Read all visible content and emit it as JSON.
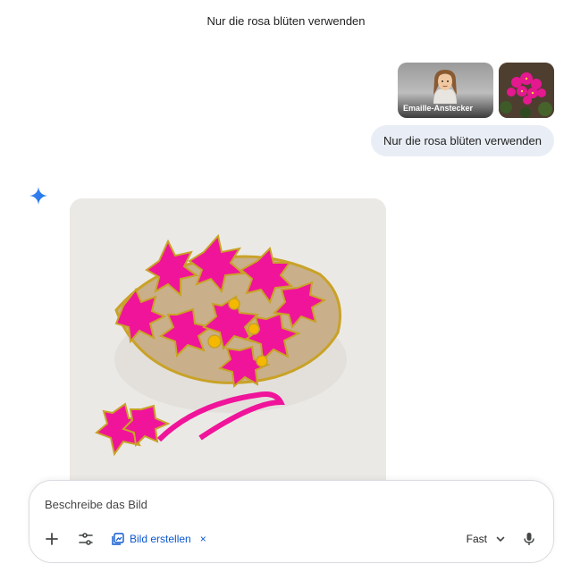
{
  "chat": {
    "title": "Nur die rosa blüten verwenden"
  },
  "attachments": [
    {
      "label": "Emaille-Anstecker",
      "icon": "avatar-icon"
    },
    {
      "label": "",
      "icon": "flower-photo"
    }
  ],
  "user_message": {
    "text": "Nur die rosa blüten verwenden"
  },
  "response": {
    "icon": "gemini-spark-icon",
    "image": "generated-enamel-pin-pink-flowers"
  },
  "composer": {
    "placeholder": "Beschreibe das Bild",
    "chip_label": "Bild erstellen",
    "chip_close": "×",
    "model_label": "Fast",
    "plus_icon": "plus-icon",
    "tools_icon": "tools-icon",
    "mic_icon": "mic-icon"
  },
  "colors": {
    "accent": "#0b57d0",
    "bubble": "#e9eef6",
    "pink": "#f0149a",
    "gold": "#c9a227"
  }
}
